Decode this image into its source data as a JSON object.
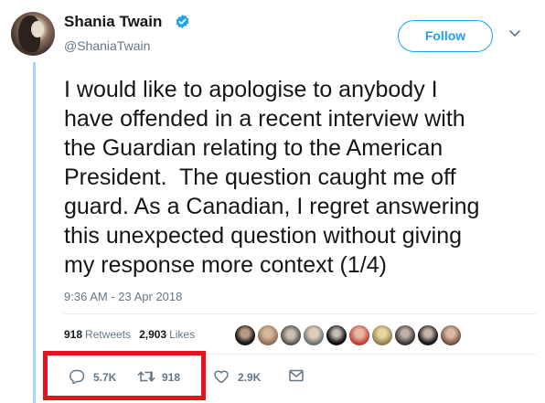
{
  "header": {
    "display_name": "Shania Twain",
    "handle": "@ShaniaTwain",
    "verified": true,
    "follow_label": "Follow",
    "accent_color": "#1da1f2"
  },
  "tweet": {
    "lines": [
      "I would like to apologise to anybody I",
      "have offended in a recent interview with",
      "the Guardian relating to the American",
      "President.  The question caught me off",
      "guard. As a Canadian, I regret answering",
      "this unexpected question without giving",
      "my response more context (1/4)"
    ],
    "timestamp": "9:36 AM - 23 Apr 2018"
  },
  "stats": {
    "retweets_count": "918",
    "retweets_label": "Retweets",
    "likes_count": "2,903",
    "likes_label": "Likes"
  },
  "actions": {
    "reply_count": "5.7K",
    "retweet_count": "918",
    "like_count": "2.9K"
  },
  "icons": {
    "verified": "verified-badge-icon",
    "chevron": "chevron-down-icon",
    "reply": "reply-bubble-icon",
    "retweet": "retweet-arrows-icon",
    "like": "heart-icon",
    "dm": "envelope-icon"
  },
  "colors": {
    "highlight": "#e8121f",
    "thread_line": "#a6d6f2",
    "muted_text": "#657786"
  }
}
